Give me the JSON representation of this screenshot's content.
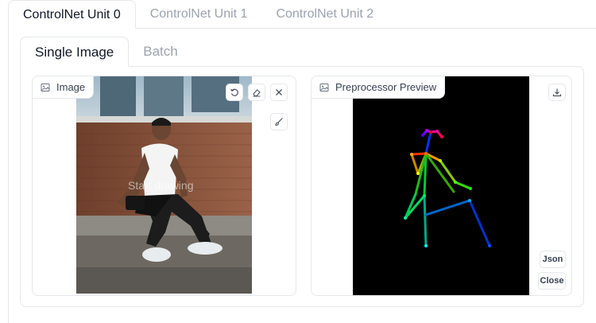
{
  "outer_tabs": [
    "ControlNet Unit 0",
    "ControlNet Unit 1",
    "ControlNet Unit 2"
  ],
  "inner_tabs": [
    "Single Image",
    "Batch"
  ],
  "image_panel": {
    "label": "Image",
    "hint": "Start drawing",
    "icons": [
      "image-icon",
      "undo-icon",
      "eraser-icon",
      "close-icon",
      "brush-icon"
    ]
  },
  "preview_panel": {
    "label": "Preprocessor Preview",
    "json_button": "Json",
    "close_button": "Close",
    "icons": [
      "image-icon",
      "download-icon"
    ]
  }
}
